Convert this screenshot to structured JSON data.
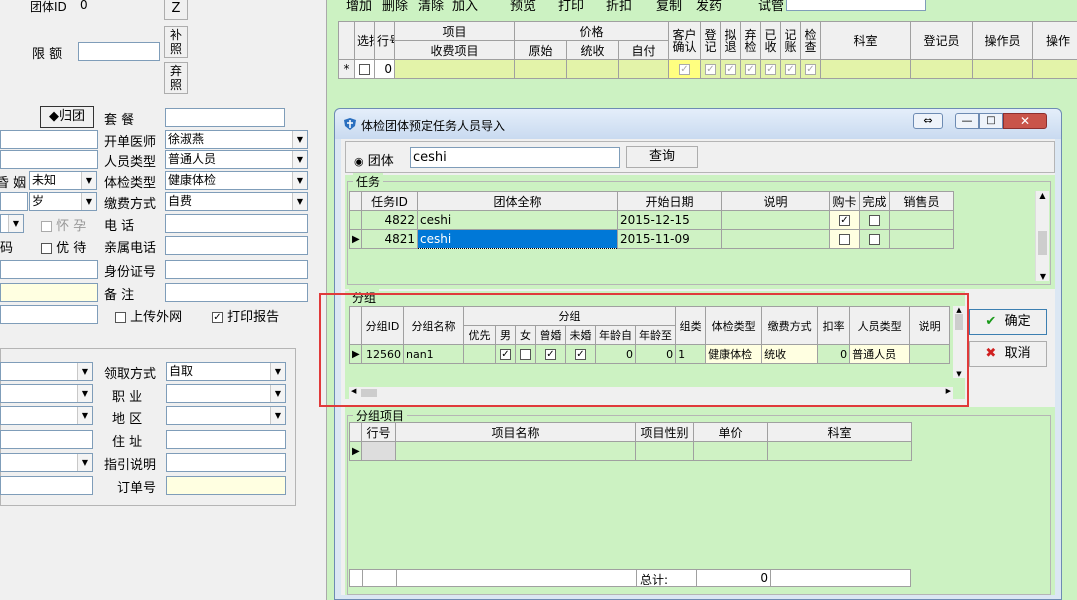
{
  "left": {
    "group_id_label": "团体ID",
    "group_id_value": "0",
    "limit_label": "限  额",
    "btn_z": "Z",
    "btn_supplement": "补照",
    "btn_discard": "弃照",
    "return_group_btn": "◆归团",
    "package_label": "套  餐",
    "doctor_label": "开单医师",
    "doctor_value": "徐淑燕",
    "person_type_label": "人员类型",
    "person_type_value": "普通人员",
    "marital_label_fragment": "昏  姻",
    "marital_value": "未知",
    "exam_type_label": "体检类型",
    "exam_type_value": "健康体检",
    "age_unit": "岁",
    "pay_method_label": "缴费方式",
    "pay_method_value": "自费",
    "pregnant_label": "怀 孕",
    "phone_label": "电  话",
    "code_fragment": "码",
    "priority_label": "优 待",
    "relative_phone_label": "亲属电话",
    "id_number_label": "身份证号",
    "remark_label": "备  注",
    "upload_label": "上传外网",
    "print_report_label": "打印报告",
    "collect_label": "领取方式",
    "collect_value": "自取",
    "job_label": "职  业",
    "region_label": "地  区",
    "address_label": "住  址",
    "guide_label": "指引说明",
    "order_label": "订单号"
  },
  "toolbar": [
    "增加",
    "删除",
    "清除",
    "加入",
    "预览",
    "打印",
    "折扣",
    "复制",
    "发药",
    "试管"
  ],
  "main_grid": {
    "headers": [
      "选择",
      "行号",
      "项目",
      "收费项目",
      "价格",
      "原始",
      "统收",
      "自付",
      "客户确认",
      "登记",
      "拟退",
      "弃检",
      "已收",
      "记账",
      "检查",
      "科室",
      "登记员",
      "操作员",
      "操作"
    ],
    "row_marker": "*",
    "row_no": "0"
  },
  "dialog": {
    "title": "体检团体预定任务人员导入",
    "radio_label": "团体",
    "search_value": "ceshi",
    "query_btn": "查询",
    "task_section": "任务",
    "task_headers": [
      "任务ID",
      "团体全称",
      "开始日期",
      "说明",
      "购卡",
      "完成",
      "销售员"
    ],
    "tasks": [
      {
        "id": "4822",
        "name": "ceshi",
        "date": "2015-12-15",
        "card": "✓"
      },
      {
        "id": "4821",
        "name": "ceshi",
        "date": "2015-11-09",
        "card": ""
      }
    ],
    "group_section": "分组",
    "group_headers": [
      "分组ID",
      "分组名称",
      "分组",
      "优先",
      "男",
      "女",
      "曾婚",
      "未婚",
      "年龄自",
      "年龄至",
      "组类",
      "体检类型",
      "缴费方式",
      "扣率",
      "人员类型",
      "说明"
    ],
    "groups": [
      {
        "id": "12560",
        "name": "nan1",
        "male": "✓",
        "female": "",
        "married": "✓",
        "unmarried": "✓",
        "age_from": "0",
        "age_to": "0",
        "type": "1",
        "exam_type": "健康体检",
        "pay": "统收",
        "rate": "0",
        "person_type": "普通人员"
      }
    ],
    "confirm_btn": "确定",
    "cancel_btn": "取消",
    "items_section": "分组项目",
    "item_headers": [
      "行号",
      "项目名称",
      "项目性别",
      "单价",
      "科室"
    ],
    "total_label": "总计:",
    "total_value": "0"
  }
}
